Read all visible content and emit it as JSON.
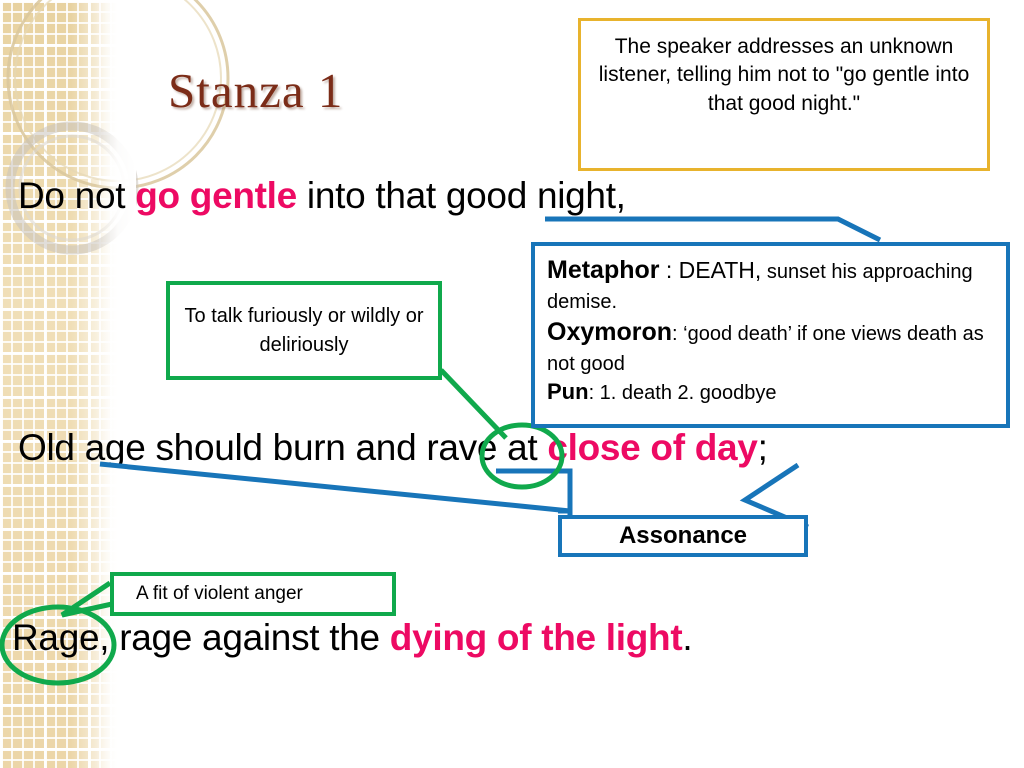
{
  "slide": {
    "title": "Stanza  1",
    "title_color": "#7b2c18",
    "background_color": "#ffffff"
  },
  "poem": {
    "line1": {
      "part1": "Do not ",
      "highlight": "go gentle",
      "part2": " into that good night,"
    },
    "line2": {
      "part1": "Old age should burn and rave at ",
      "highlight": "close of day",
      "part2": ";"
    },
    "line3": {
      "part1": "Rage, rage against the ",
      "highlight": "dying of the light",
      "part2": "."
    },
    "highlight_color": "#ed0a63"
  },
  "annotations": {
    "speaker_note": {
      "text": "The speaker addresses an unknown listener, telling him not to \"go gentle into that good night.\"",
      "border_color": "#e8b32d"
    },
    "rave_definition": {
      "text": "To talk furiously or wildly or deliriously",
      "border_color": "#10a94c"
    },
    "rage_definition": {
      "text": "A fit of violent anger",
      "border_color": "#10a94c"
    },
    "devices": {
      "border_color": "#1875b9",
      "metaphor_label": "Metaphor",
      "metaphor_text": " : DEATH,",
      "metaphor_text_small": " sunset his approaching demise.",
      "oxymoron_label": "Oxymoron",
      "oxymoron_text": ": ‘good death’ if one views death as not good",
      "pun_label": "Pun",
      "pun_text": ": 1. death 2. goodbye"
    },
    "assonance": {
      "label": "Assonance",
      "border_color": "#1875b9"
    }
  },
  "marks": {
    "circle_color": "#10a94c",
    "underline_color": "#1875b9",
    "circled_words": [
      "rave",
      "Rage,"
    ],
    "underlined_words": [
      "good night,",
      "age",
      "rave",
      "day"
    ]
  }
}
